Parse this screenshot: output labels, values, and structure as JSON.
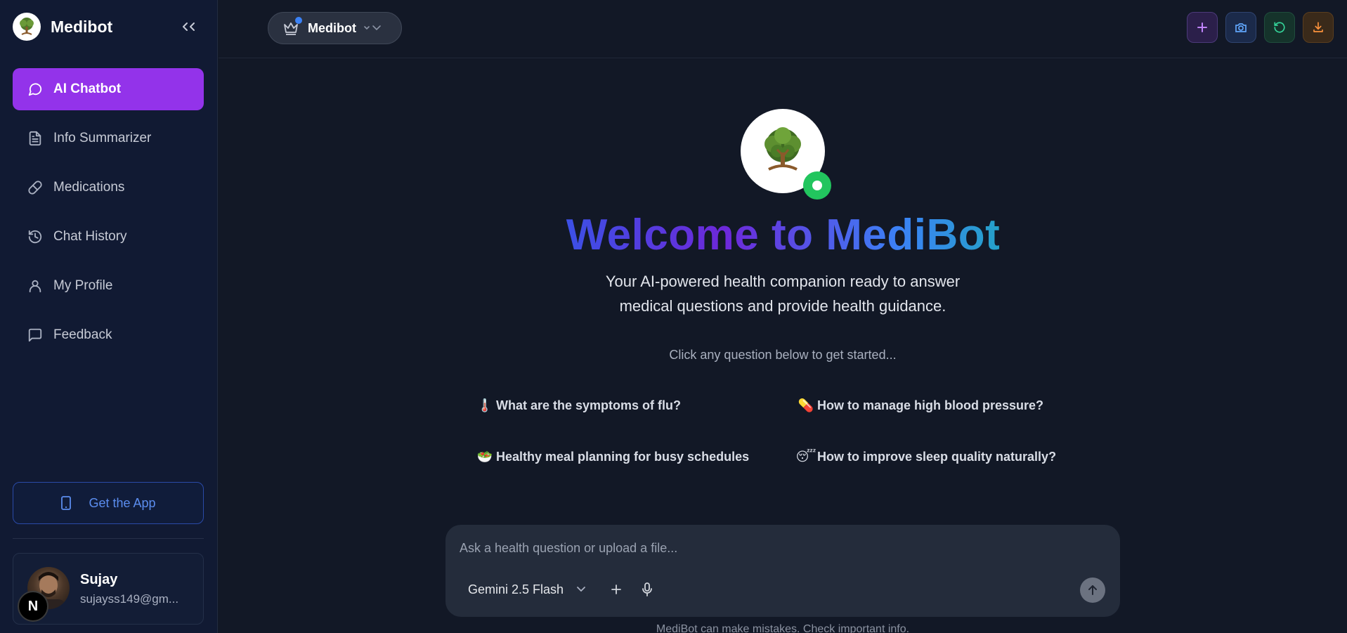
{
  "sidebar": {
    "brand_name": "Medibot",
    "items": [
      {
        "label": "AI Chatbot",
        "icon": "message-circle-icon",
        "active": true
      },
      {
        "label": "Info Summarizer",
        "icon": "document-icon"
      },
      {
        "label": "Medications",
        "icon": "pill-icon"
      },
      {
        "label": "Chat History",
        "icon": "history-icon"
      },
      {
        "label": "My Profile",
        "icon": "user-icon"
      },
      {
        "label": "Feedback",
        "icon": "feedback-icon"
      }
    ],
    "get_app_label": "Get the App",
    "profile": {
      "name": "Sujay",
      "email": "sujayss149@gm...",
      "badge": "N"
    }
  },
  "header": {
    "model_switch_label": "Medibot",
    "tools": [
      "new-chat-icon",
      "camera-icon",
      "refresh-icon",
      "download-icon"
    ]
  },
  "main": {
    "welcome_title": "Welcome to MediBot",
    "subtitle_line1": "Your AI-powered health companion ready to answer",
    "subtitle_line2": "medical questions and provide health guidance.",
    "hint": "Click any question below to get started...",
    "suggestions": [
      {
        "emoji": "🌡️",
        "text": "What are the symptoms of flu?"
      },
      {
        "emoji": "💊",
        "text": "How to manage high blood pressure?"
      },
      {
        "emoji": "🥗",
        "text": "Healthy meal planning for busy schedules"
      },
      {
        "emoji": "😴",
        "text": "How to improve sleep quality naturally?"
      }
    ]
  },
  "composer": {
    "placeholder": "Ask a health question or upload a file...",
    "model": "Gemini 2.5 Flash",
    "disclaimer": "MediBot can make mistakes. Check important info."
  },
  "colors": {
    "accent": "#9333ea",
    "online": "#22c55e",
    "background": "#121826",
    "sidebar": "#111a33"
  }
}
